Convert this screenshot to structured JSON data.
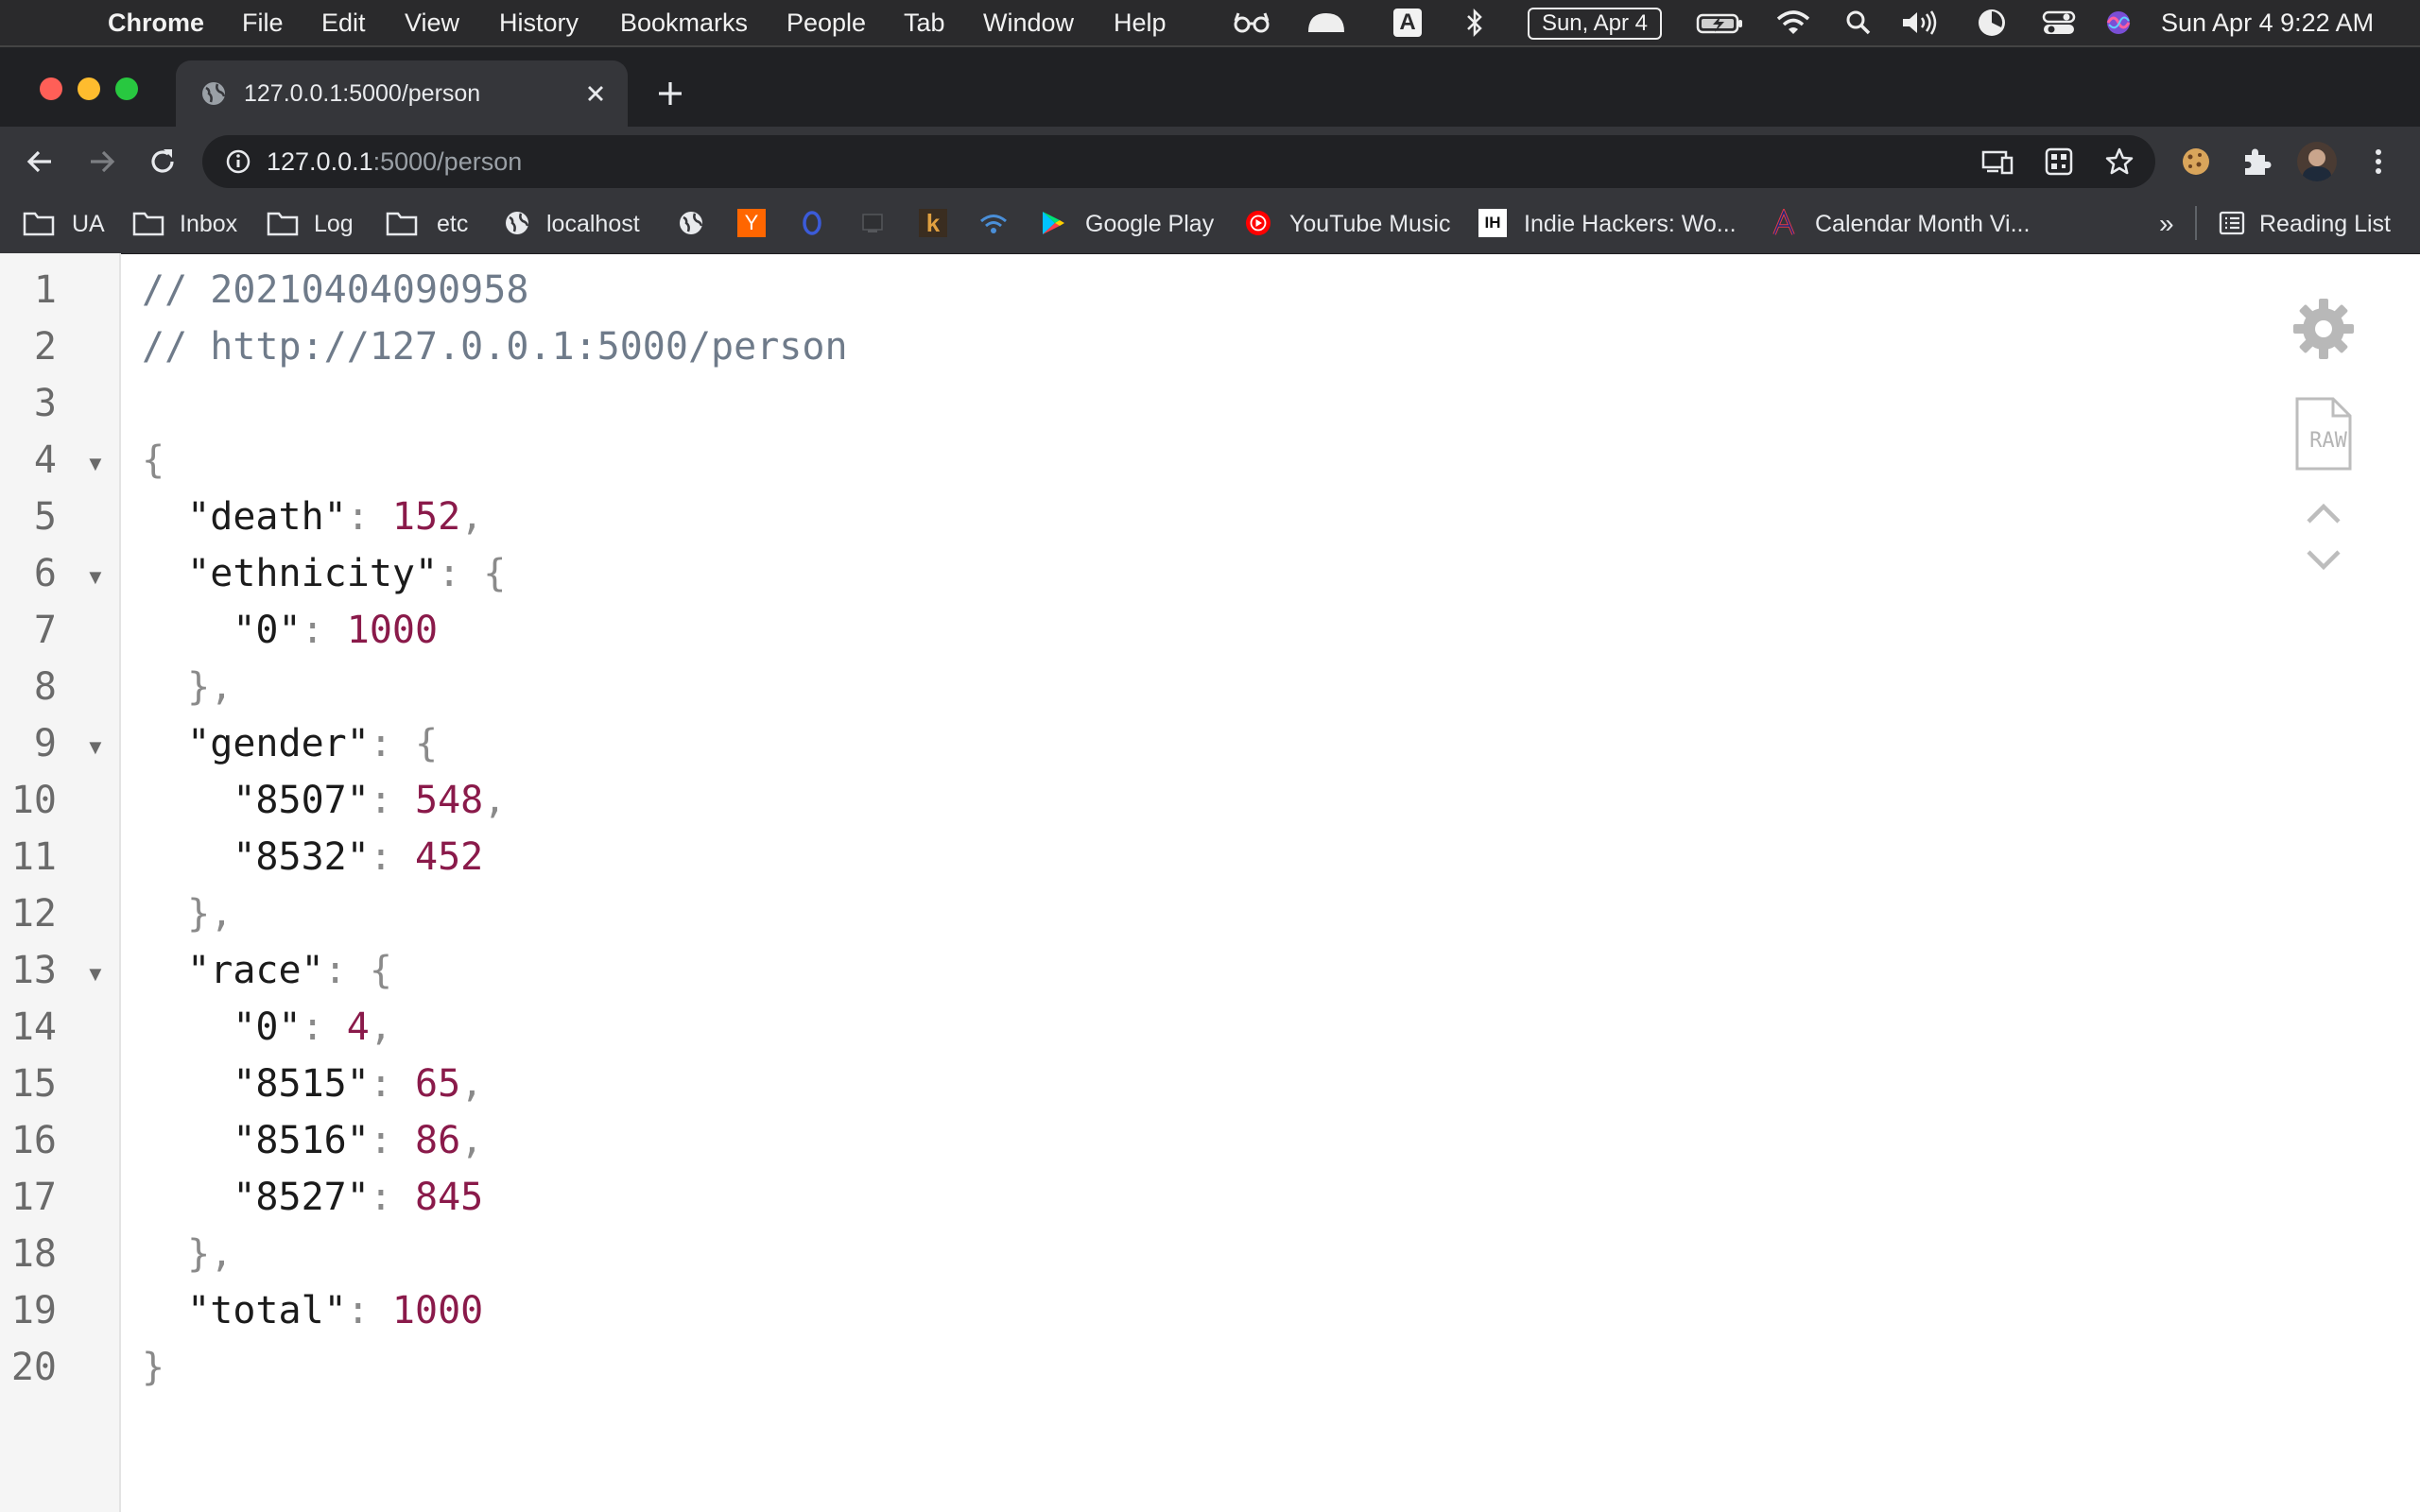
{
  "menubar": {
    "app": "Chrome",
    "items": [
      "File",
      "Edit",
      "View",
      "History",
      "Bookmarks",
      "People",
      "Tab",
      "Window",
      "Help"
    ],
    "date_badge": "Sun, Apr 4",
    "input_badge": "A",
    "clock": "Sun Apr 4  9:22 AM"
  },
  "tab": {
    "title": "127.0.0.1:5000/person"
  },
  "omnibox": {
    "host": "127.0.0.1",
    "path": ":5000/person"
  },
  "bookmarks": {
    "items": [
      "UA",
      "Inbox",
      "Log",
      "etc",
      "localhost",
      "Google Play",
      "YouTube Music",
      "Indie Hackers: Wo...",
      "Calendar Month Vi..."
    ],
    "overflow": "»",
    "reading_list": "Reading List"
  },
  "viewer": {
    "line_numbers": [
      "1",
      "2",
      "3",
      "4",
      "5",
      "6",
      "7",
      "8",
      "9",
      "10",
      "11",
      "12",
      "13",
      "14",
      "15",
      "16",
      "17",
      "18",
      "19",
      "20"
    ],
    "timestamp_comment": "// 20210404090958",
    "url_comment": "// http://127.0.0.1:5000/person",
    "json": {
      "death": {
        "key": "\"death\"",
        "value": "152"
      },
      "ethnicity": {
        "key": "\"ethnicity\"",
        "entries": [
          {
            "key": "\"0\"",
            "value": "1000"
          }
        ]
      },
      "gender": {
        "key": "\"gender\"",
        "entries": [
          {
            "key": "\"8507\"",
            "value": "548"
          },
          {
            "key": "\"8532\"",
            "value": "452"
          }
        ]
      },
      "race": {
        "key": "\"race\"",
        "entries": [
          {
            "key": "\"0\"",
            "value": "4"
          },
          {
            "key": "\"8515\"",
            "value": "65"
          },
          {
            "key": "\"8516\"",
            "value": "86"
          },
          {
            "key": "\"8527\"",
            "value": "845"
          }
        ]
      },
      "total": {
        "key": "\"total\"",
        "value": "1000"
      }
    },
    "raw_label": "RAW"
  },
  "colors": {
    "number": "#8a1a4a",
    "comment": "#6f7b8a",
    "chrome_dark": "#202124"
  }
}
